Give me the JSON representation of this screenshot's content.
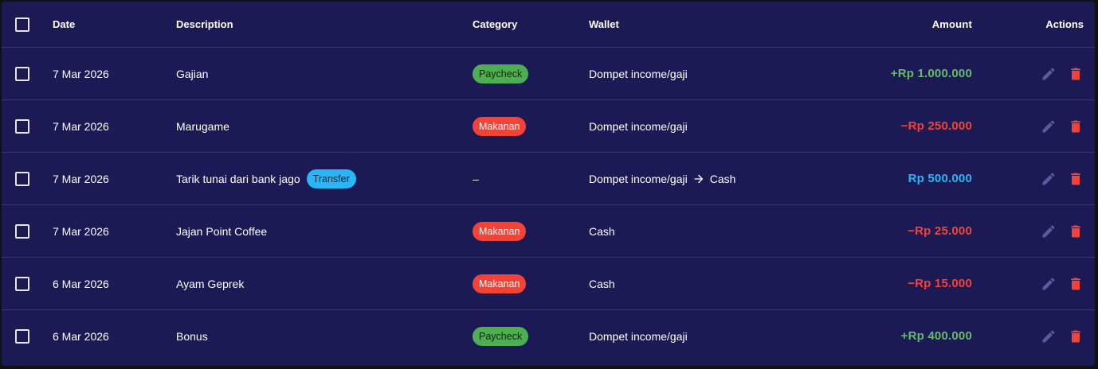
{
  "table": {
    "headers": {
      "date": "Date",
      "description": "Description",
      "category": "Category",
      "wallet": "Wallet",
      "amount": "Amount",
      "actions": "Actions"
    },
    "rows": [
      {
        "date": "7 Mar 2026",
        "description": "Gajian",
        "category": "Paycheck",
        "category_color": "#4caf50",
        "wallet": "Dompet income/gaji",
        "amount": "+Rp 1.000.000",
        "amount_color": "#66bb6a"
      },
      {
        "date": "7 Mar 2026",
        "description": "Marugame",
        "category": "Makanan",
        "category_color": "#f44336",
        "wallet": "Dompet income/gaji",
        "amount": "−Rp 250.000",
        "amount_color": "#f44336"
      },
      {
        "date": "7 Mar 2026",
        "description": "Tarik tunai dari bank jago",
        "tag": "Transfer",
        "category": "–",
        "wallet_from": "Dompet income/gaji",
        "wallet_to": "Cash",
        "amount": "Rp 500.000",
        "amount_color": "#29b6f6"
      },
      {
        "date": "7 Mar 2026",
        "description": "Jajan Point Coffee",
        "category": "Makanan",
        "category_color": "#f44336",
        "wallet": "Cash",
        "amount": "−Rp 25.000",
        "amount_color": "#f44336"
      },
      {
        "date": "6 Mar 2026",
        "description": "Ayam Geprek",
        "category": "Makanan",
        "category_color": "#f44336",
        "wallet": "Cash",
        "amount": "−Rp 15.000",
        "amount_color": "#f44336"
      },
      {
        "date": "6 Mar 2026",
        "description": "Bonus",
        "category": "Paycheck",
        "category_color": "#4caf50",
        "wallet": "Dompet income/gaji",
        "amount": "+Rp 400.000",
        "amount_color": "#66bb6a"
      }
    ]
  },
  "icons": {
    "edit": "pencil-icon",
    "delete": "trash-icon",
    "arrow": "arrow-right-icon"
  },
  "colors": {
    "background": "#1c1a55",
    "divider": "#34327a",
    "edit_icon": "#5c5a9e",
    "delete_icon": "#f44336"
  }
}
